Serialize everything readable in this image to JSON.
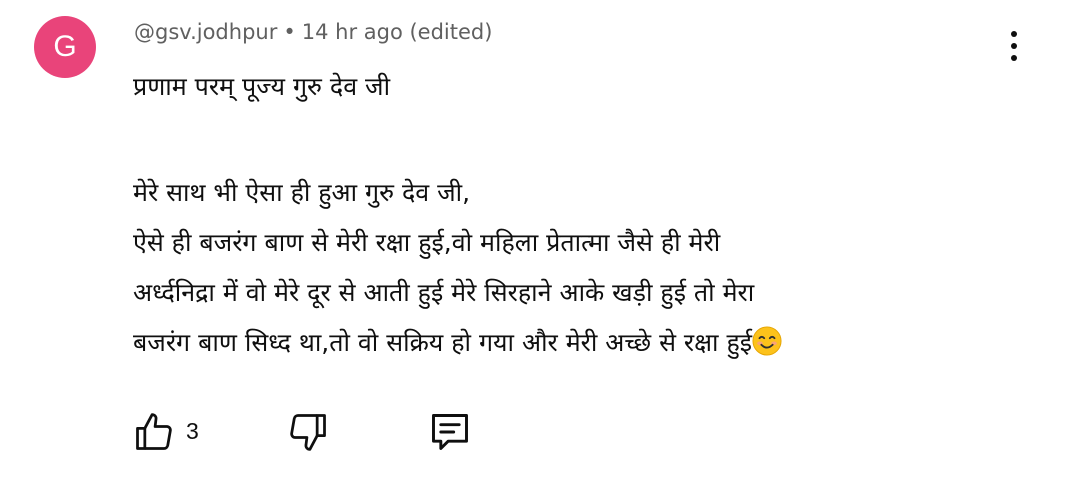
{
  "comment": {
    "avatar_letter": "G",
    "avatar_color": "#e9447a",
    "author": "@gsv.jodhpur",
    "separator": "•",
    "time": "14 hr ago (edited)",
    "lines": [
      "प्रणाम परम् पूज्य गुरु देव जी",
      "मेरे साथ भी ऐसा ही हुआ गुरु देव जी,",
      "ऐसे ही बजरंग बाण से मेरी  रक्षा हुई,वो महिला प्रेतात्मा जैसे ही मेरी",
      "अर्ध्दनिद्रा में वो मेरे दूर से आती हुई मेरे सिरहाने आके खड़ी हुई तो मेरा",
      "बजरंग बाण सिध्द था,तो वो सक्रिय हो गया और मेरी अच्छे से रक्षा हुई"
    ],
    "emoji": "smiling-face-emoji",
    "like_count": "3",
    "icons": {
      "menu": "more-vertical-icon",
      "like": "thumbs-up-icon",
      "dislike": "thumbs-down-icon",
      "reply": "comment-reply-icon"
    }
  }
}
